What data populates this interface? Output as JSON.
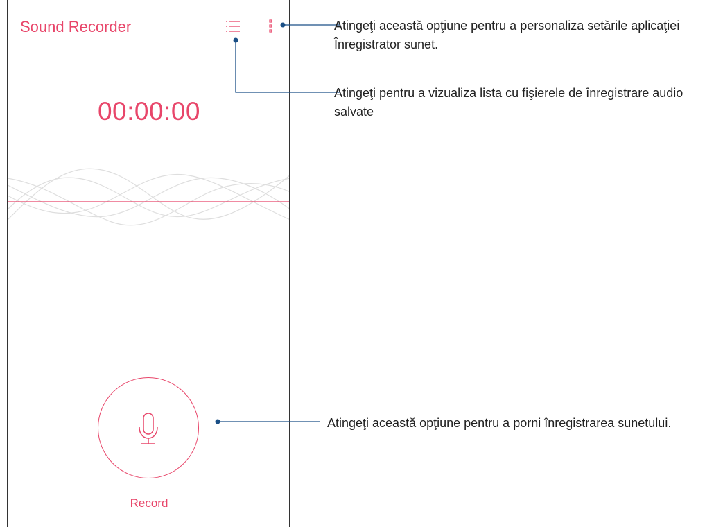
{
  "app": {
    "title": "Sound Recorder",
    "accent_color": "#e8466a"
  },
  "toolbar": {
    "list_icon": "list-icon",
    "more_icon": "more-vertical-icon"
  },
  "timer": {
    "value": "00:00:00"
  },
  "record": {
    "icon": "microphone-icon",
    "label": "Record"
  },
  "callouts": {
    "settings": "Atingeţi această opţiune pentru a personaliza setările aplicaţiei Înregistrator sunet.",
    "list": "Atingeţi pentru a vizualiza lista cu fişierele de înregistrare audio salvate",
    "record": "Atingeţi această opţiune pentru a porni înregistrarea sunetului.",
    "line_color": "#1a4f86"
  }
}
